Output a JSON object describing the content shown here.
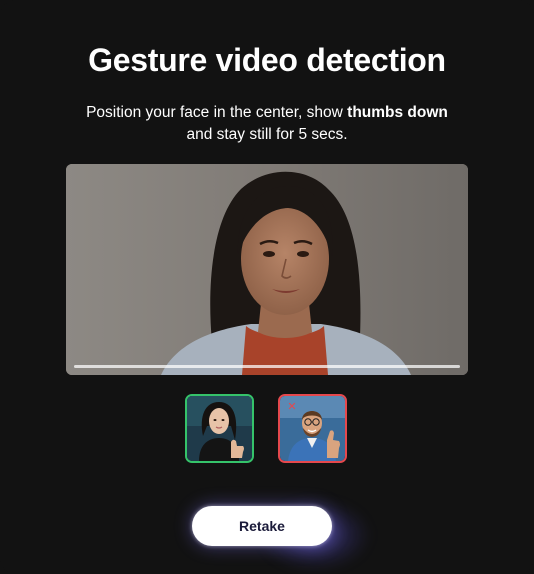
{
  "dialog": {
    "title": "Gesture video detection",
    "instruction": {
      "before": "Position your face in the center, show ",
      "emphasis": "thumbs down",
      "after": "and stay still for 5 secs."
    }
  },
  "video": {
    "progress": 1.0
  },
  "examples": [
    {
      "status": "correct",
      "border_color": "#35c36a"
    },
    {
      "status": "incorrect",
      "border_color": "#e5484d",
      "marker": "✕"
    }
  ],
  "actions": {
    "retake_label": "Retake"
  },
  "colors": {
    "background": "#121212",
    "correct": "#35c36a",
    "incorrect": "#e5484d",
    "button_text": "#1b1b3a",
    "glow": "#7a6eff"
  }
}
